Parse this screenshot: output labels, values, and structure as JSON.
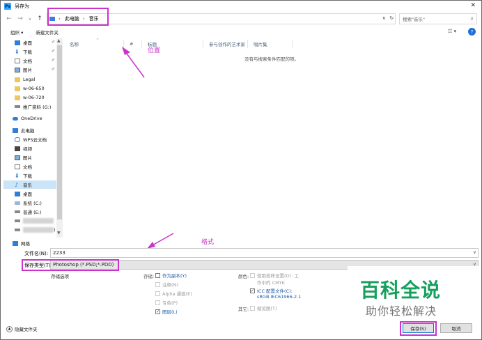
{
  "window": {
    "title": "另存为",
    "app_icon": "Ps",
    "close": "✕"
  },
  "nav": {
    "back": "←",
    "forward": "→",
    "recent": "∨",
    "up": "↑"
  },
  "address": {
    "segments": [
      "此电脑",
      "音乐"
    ],
    "sep": "›",
    "dropdown": "∨",
    "refresh": "↻"
  },
  "search": {
    "placeholder": "搜索\"音乐\"",
    "icon": "⌕"
  },
  "toolbar": {
    "organize": "组织 ▾",
    "new_folder": "新建文件夹",
    "view": "☷ ▾",
    "help": "?"
  },
  "sidebar": {
    "items": [
      {
        "label": "桌面",
        "icon": "desktop-icon",
        "pinned": true
      },
      {
        "label": "下载",
        "icon": "download-icon",
        "pinned": true
      },
      {
        "label": "文档",
        "icon": "document-icon",
        "pinned": true
      },
      {
        "label": "图片",
        "icon": "picture-icon",
        "pinned": true
      },
      {
        "label": "Legal",
        "icon": "folder-icon"
      },
      {
        "label": "w-06-650",
        "icon": "folder-icon"
      },
      {
        "label": "w-06-720",
        "icon": "folder-icon"
      },
      {
        "label": "推广资料 (G:)",
        "icon": "drive-icon"
      },
      {
        "label": "OneDrive",
        "icon": "cloud-icon"
      },
      {
        "label": "此电脑",
        "icon": "pc-icon"
      },
      {
        "label": "WPS云文档",
        "icon": "wps-icon"
      },
      {
        "label": "视频",
        "icon": "video-icon"
      },
      {
        "label": "图片",
        "icon": "picture-icon"
      },
      {
        "label": "文档",
        "icon": "document-icon"
      },
      {
        "label": "下载",
        "icon": "download-icon"
      },
      {
        "label": "音乐",
        "icon": "music-icon",
        "selected": true
      },
      {
        "label": "桌面",
        "icon": "desktop-icon"
      },
      {
        "label": "系统 (C:)",
        "icon": "system-drive-icon"
      },
      {
        "label": "普通 (E:)",
        "icon": "drive-icon"
      },
      {
        "label": "",
        "icon": "drive-icon",
        "blurred": true
      },
      {
        "label": ")",
        "icon": "drive-icon",
        "blurred": true
      },
      {
        "label": "网络",
        "icon": "network-icon"
      }
    ],
    "pin_glyph": "✐"
  },
  "list": {
    "columns": [
      "名称",
      "#",
      "标题",
      "参与创作的艺术家",
      "唱片集"
    ],
    "sort_glyph": "^",
    "empty_message": "没有与搜索条件匹配的项。"
  },
  "annotations": {
    "position": "位置",
    "format": "格式"
  },
  "fields": {
    "filename_label": "文件名(N):",
    "filename_value": "2233",
    "filetype_label": "保存类型(T):",
    "filetype_value": "Photoshop (*.PSD;*.PDD)",
    "dropdown": "∨"
  },
  "save_options": {
    "title": "存储选项",
    "storage_label": "存储:",
    "as_copy": "作为副本(Y)",
    "notes": "注释(N)",
    "alpha": "Alpha 通道(E)",
    "spot": "专色(P)",
    "layers": "图层(L)",
    "color_label": "颜色:",
    "use_proof": "使用校样设置(O): 工",
    "use_proof_2": "作中的 CMYK",
    "icc": "ICC 配置文件(C):",
    "icc_2": "sRGB IEC61966-2.1",
    "other_label": "其它:",
    "thumbnail": "缩览图(T)",
    "check": "✓"
  },
  "watermark": {
    "big": "百科全说",
    "small": "助你轻松解决"
  },
  "footer": {
    "hide_folders": "隐藏文件夹",
    "hide_arrow": "▲",
    "save": "保存(S)",
    "cancel": "取消"
  },
  "colors": {
    "highlight": "#cc33cc",
    "watermark": "#16a05d",
    "link": "#1e5aa8"
  }
}
